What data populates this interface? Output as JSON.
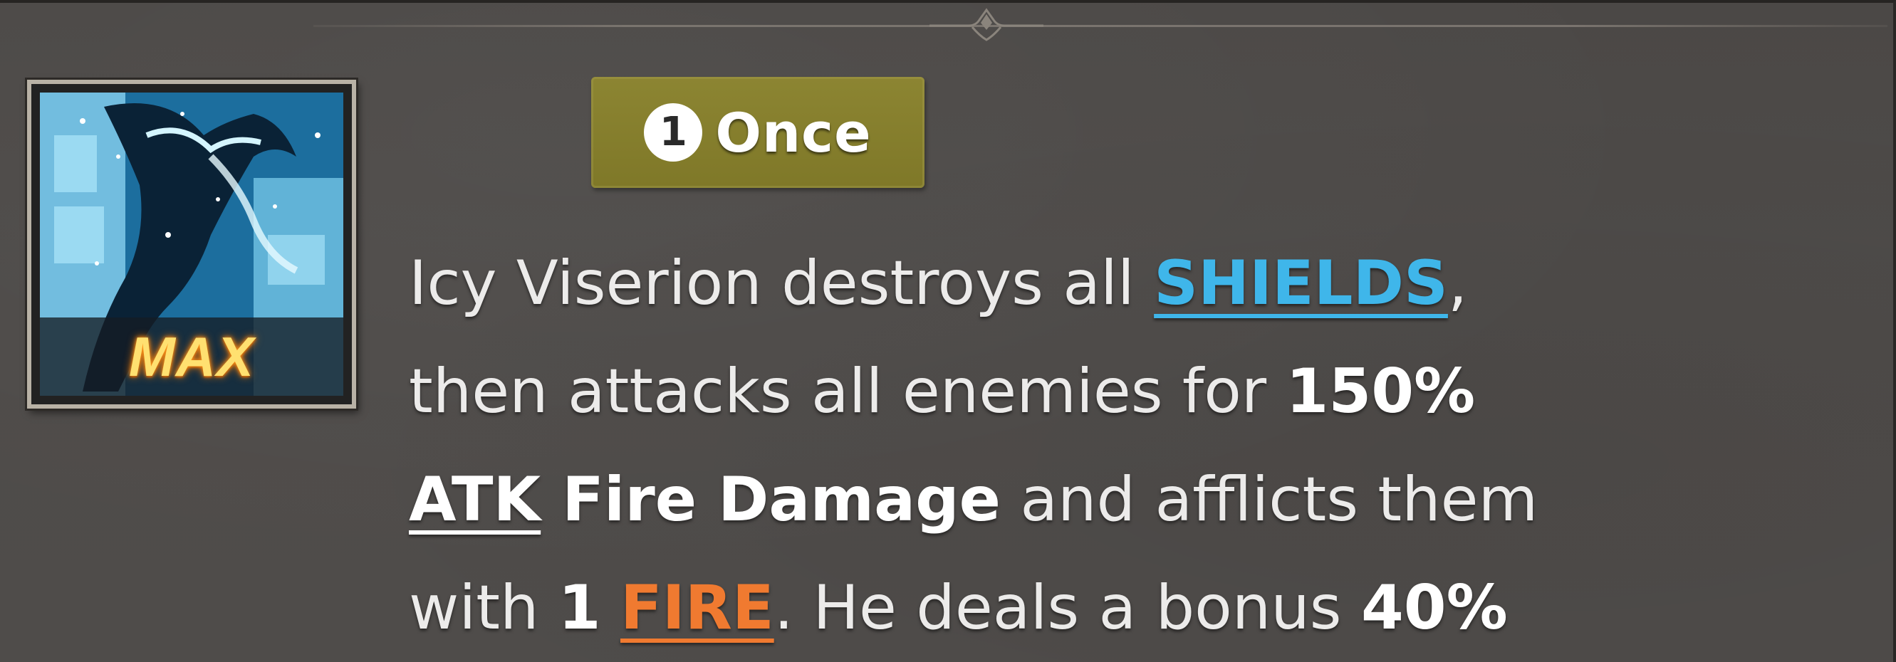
{
  "skill": {
    "icon_name": "ice-dragon-skill-icon",
    "level_badge": "MAX",
    "frequency": {
      "count": "1",
      "label": "Once"
    },
    "description": {
      "line1": {
        "text_a": "Icy Viserion destroys all ",
        "keyword_shields": "SHIELDS",
        "text_b": ","
      },
      "line2": {
        "text_a": "then attacks all enemies for ",
        "value_atk_pct": "150%"
      },
      "line3": {
        "keyword_atk": "ATK",
        "damage_type": " Fire Damage",
        "text_a": " and afflicts them"
      },
      "line4": {
        "text_a": "with ",
        "fire_count": "1",
        "keyword_fire": "FIRE",
        "text_b": ". He deals a bonus ",
        "bonus_pct": "40%"
      }
    }
  },
  "colors": {
    "panel_bg": "#4e4b49",
    "shield_keyword": "#3fb6ea",
    "fire_keyword": "#f07a30",
    "once_badge": "#857e2d",
    "max_text": "#ffe070"
  }
}
